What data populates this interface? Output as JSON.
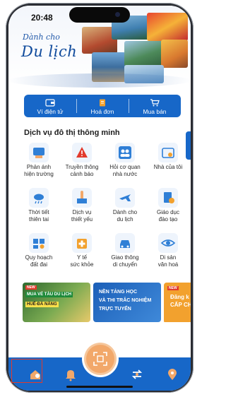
{
  "status_bar": {
    "time": "20:48"
  },
  "hero": {
    "title_line1": "Dành cho",
    "title_line2": "Du lịch"
  },
  "quick_tabs": [
    {
      "label": "Ví điện tử",
      "icon": "wallet-icon"
    },
    {
      "label": "Hoá đơn",
      "icon": "invoice-icon"
    },
    {
      "label": "Mua bán",
      "icon": "cart-icon"
    }
  ],
  "section": {
    "title": "Dịch vụ đô thị thông minh"
  },
  "services": [
    {
      "line1": "Phản ánh",
      "line2": "hiện trường",
      "icon": "report-icon",
      "color": "#2f7fd6"
    },
    {
      "line1": "Truyền thông",
      "line2": "cảnh báo",
      "icon": "warning-icon",
      "color": "#e23a2c"
    },
    {
      "line1": "Hỏi cơ quan",
      "line2": "nhà nước",
      "icon": "people-icon",
      "color": "#2f7fd6"
    },
    {
      "line1": "Nhà của tôi",
      "line2": "",
      "icon": "home-icon",
      "color": "#2f7fd6"
    },
    {
      "line1": "Thời tiết",
      "line2": "thiên tai",
      "icon": "weather-icon",
      "color": "#2f7fd6"
    },
    {
      "line1": "Dịch vụ",
      "line2": "thiết yếu",
      "icon": "utility-icon",
      "color": "#2f7fd6"
    },
    {
      "line1": "Dành cho",
      "line2": "du lịch",
      "icon": "plane-icon",
      "color": "#2f7fd6"
    },
    {
      "line1": "Giáo dục",
      "line2": "đào tạo",
      "icon": "education-icon",
      "color": "#f2a12e"
    },
    {
      "line1": "Quy hoạch",
      "line2": "đất đai",
      "icon": "map-pin-icon",
      "color": "#2f7fd6"
    },
    {
      "line1": "Y tế",
      "line2": "sức khỏe",
      "icon": "medical-icon",
      "color": "#f2a12e"
    },
    {
      "line1": "Giao thông",
      "line2": "di chuyển",
      "icon": "car-icon",
      "color": "#2f7fd6"
    },
    {
      "line1": "Di sản",
      "line2": "văn hoá",
      "icon": "eye-icon",
      "color": "#2f7fd6"
    }
  ],
  "banners": [
    {
      "badge": "NEW",
      "line1": "MUA VÉ TÀU DU LỊCH",
      "line2": "HUẾ-ĐÀ NẴNG"
    },
    {
      "line1": "NỀN TẢNG HỌC",
      "line2": "VÀ THI TRẮC NGHIỆM",
      "line3": "TRỰC TUYẾN"
    },
    {
      "badge": "NEW",
      "line1": "Đăng k",
      "line2": "CẤP CH"
    }
  ],
  "bottom_nav": [
    {
      "icon": "home-user-icon",
      "selected": true
    },
    {
      "icon": "bell-icon"
    },
    {
      "icon": "qr-scan-icon"
    },
    {
      "icon": "transfer-icon"
    },
    {
      "icon": "location-icon"
    }
  ],
  "colors": {
    "primary": "#1767c8",
    "accent": "#f2a86a",
    "alert": "#e23a2c"
  }
}
